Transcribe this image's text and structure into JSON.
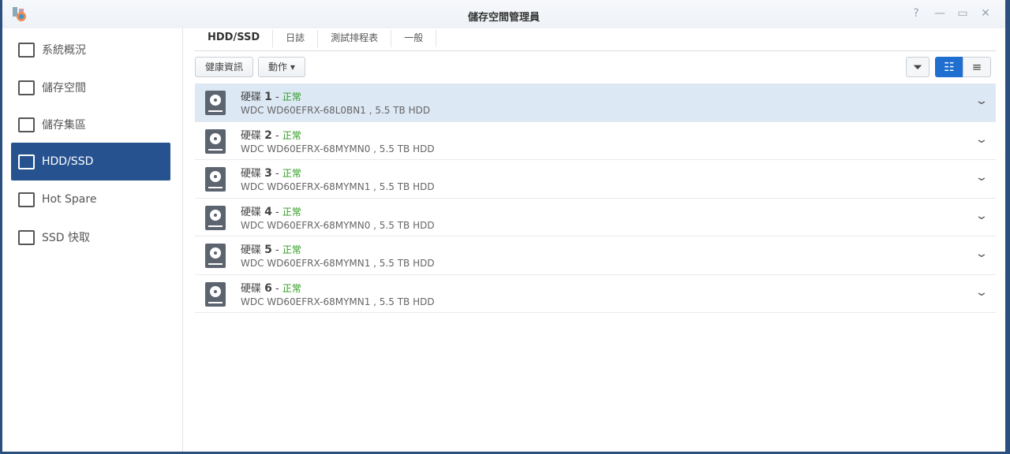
{
  "window": {
    "title": "儲存空間管理員",
    "help": "?",
    "minimize": "—",
    "maximize": "▭",
    "close": "✕"
  },
  "sidebar": {
    "items": [
      {
        "label": "系統概況",
        "icon": "overview-icon"
      },
      {
        "label": "儲存空間",
        "icon": "volume-icon"
      },
      {
        "label": "儲存集區",
        "icon": "pool-icon"
      },
      {
        "label": "HDD/SSD",
        "icon": "disk-icon"
      },
      {
        "label": "Hot Spare",
        "icon": "hot-spare-icon"
      },
      {
        "label": "SSD 快取",
        "icon": "ssd-cache-icon"
      }
    ],
    "active": 3
  },
  "tabs": [
    "HDD/SSD",
    "日誌",
    "測試排程表",
    "一般"
  ],
  "toolbar": {
    "health": "健康資訊",
    "action": "動作 ▾"
  },
  "disks": [
    {
      "name": "硬碟",
      "num": "1",
      "sep": " - ",
      "status": "正常",
      "model": "WDC WD60EFRX-68L0BN1 , 5.5 TB HDD"
    },
    {
      "name": "硬碟",
      "num": "2",
      "sep": " - ",
      "status": "正常",
      "model": "WDC WD60EFRX-68MYMN0 , 5.5 TB HDD"
    },
    {
      "name": "硬碟",
      "num": "3",
      "sep": " - ",
      "status": "正常",
      "model": "WDC WD60EFRX-68MYMN1 , 5.5 TB HDD"
    },
    {
      "name": "硬碟",
      "num": "4",
      "sep": " - ",
      "status": "正常",
      "model": "WDC WD60EFRX-68MYMN0 , 5.5 TB HDD"
    },
    {
      "name": "硬碟",
      "num": "5",
      "sep": " - ",
      "status": "正常",
      "model": "WDC WD60EFRX-68MYMN1 , 5.5 TB HDD"
    },
    {
      "name": "硬碟",
      "num": "6",
      "sep": " - ",
      "status": "正常",
      "model": "WDC WD60EFRX-68MYMN1 , 5.5 TB HDD"
    }
  ]
}
